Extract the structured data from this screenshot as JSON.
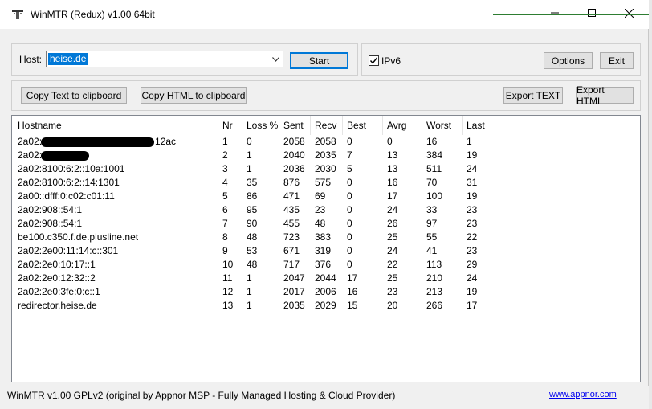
{
  "window": {
    "title": "WinMTR (Redux) v1.00 64bit",
    "icon": "winmtr-app-icon"
  },
  "host": {
    "label": "Host:",
    "value": "heise.de"
  },
  "buttons": {
    "start": "Start",
    "options": "Options",
    "exit": "Exit",
    "copy_text": "Copy Text to clipboard",
    "copy_html": "Copy HTML to clipboard",
    "export_text": "Export TEXT",
    "export_html": "Export HTML"
  },
  "ipv6": {
    "label": "IPv6",
    "checked": true
  },
  "table": {
    "columns": [
      "Hostname",
      "Nr",
      "Loss %",
      "Sent",
      "Recv",
      "Best",
      "Avrg",
      "Worst",
      "Last"
    ],
    "rows": [
      [
        "2a02:",
        "1",
        "0",
        "2058",
        "2058",
        "0",
        "0",
        "16",
        "1"
      ],
      [
        "2a02:",
        "2",
        "1",
        "2040",
        "2035",
        "7",
        "13",
        "384",
        "19"
      ],
      [
        "2a02:8100:6:2::10a:1001",
        "3",
        "1",
        "2036",
        "2030",
        "5",
        "13",
        "511",
        "24"
      ],
      [
        "2a02:8100:6:2::14:1301",
        "4",
        "35",
        "876",
        "575",
        "0",
        "16",
        "70",
        "31"
      ],
      [
        "2a00::dfff:0:c02:c01:11",
        "5",
        "86",
        "471",
        "69",
        "0",
        "17",
        "100",
        "19"
      ],
      [
        "2a02:908::54:1",
        "6",
        "95",
        "435",
        "23",
        "0",
        "24",
        "33",
        "23"
      ],
      [
        "2a02:908::54:1",
        "7",
        "90",
        "455",
        "48",
        "0",
        "26",
        "97",
        "23"
      ],
      [
        "be100.c350.f.de.plusline.net",
        "8",
        "48",
        "723",
        "383",
        "0",
        "25",
        "55",
        "22"
      ],
      [
        "2a02:2e00:11:14:c::301",
        "9",
        "53",
        "671",
        "319",
        "0",
        "24",
        "41",
        "23"
      ],
      [
        "2a02:2e0:10:17::1",
        "10",
        "48",
        "717",
        "376",
        "0",
        "22",
        "113",
        "29"
      ],
      [
        "2a02:2e0:12:32::2",
        "11",
        "1",
        "2047",
        "2044",
        "17",
        "25",
        "210",
        "24"
      ],
      [
        "2a02:2e0:3fe:0:c::1",
        "12",
        "1",
        "2017",
        "2006",
        "16",
        "23",
        "213",
        "19"
      ],
      [
        "redirector.heise.de",
        "13",
        "1",
        "2035",
        "2029",
        "15",
        "20",
        "266",
        "17"
      ]
    ],
    "row1_suffix": "12ac"
  },
  "status": {
    "text": "WinMTR v1.00 GPLv2 (original by Appnor MSP - Fully Managed Hosting & Cloud Provider)",
    "link": "www.appnor.com"
  }
}
